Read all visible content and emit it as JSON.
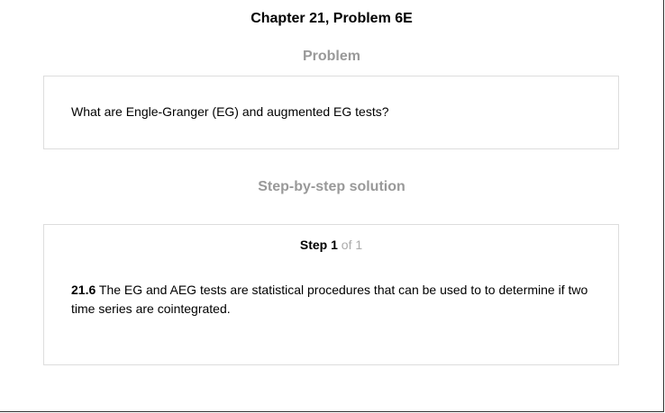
{
  "page": {
    "chapter_title": "Chapter 21, Problem 6E"
  },
  "problem": {
    "heading": "Problem",
    "text": "What are Engle-Granger (EG) and augmented EG tests?"
  },
  "solution": {
    "heading": "Step-by-step solution",
    "step": {
      "label": "Step",
      "number": "1",
      "of_text": "of 1",
      "ref_number": "21.6",
      "text": "The EG and AEG tests are statistical procedures that can be used to to determine if two time series are cointegrated."
    }
  },
  "colors": {
    "heading_gray": "#999999",
    "step_total_gray": "#aaaaaa",
    "box_border": "#dddddd"
  }
}
